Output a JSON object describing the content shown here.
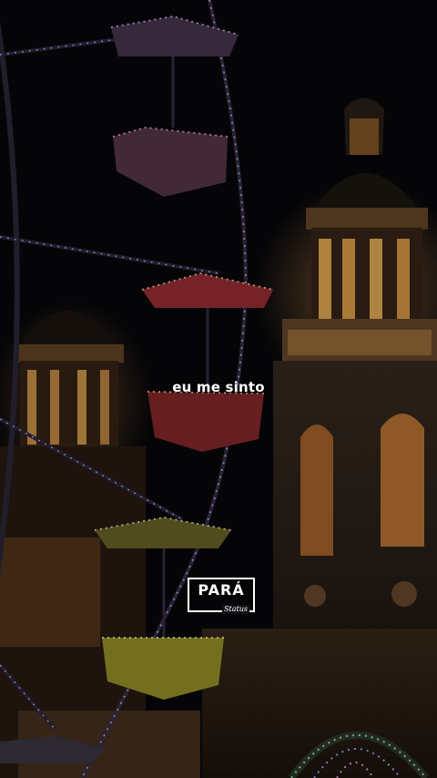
{
  "caption": {
    "text": "eu me sinto"
  },
  "watermark": {
    "title": "PARÁ",
    "subtitle": "Status"
  },
  "colors": {
    "night": "#07060a",
    "tower_light": "#d59a47",
    "ferris_lights": "#d7b3ff",
    "gondola_red": "#a3313a",
    "gondola_yellow": "#c8c23a"
  }
}
